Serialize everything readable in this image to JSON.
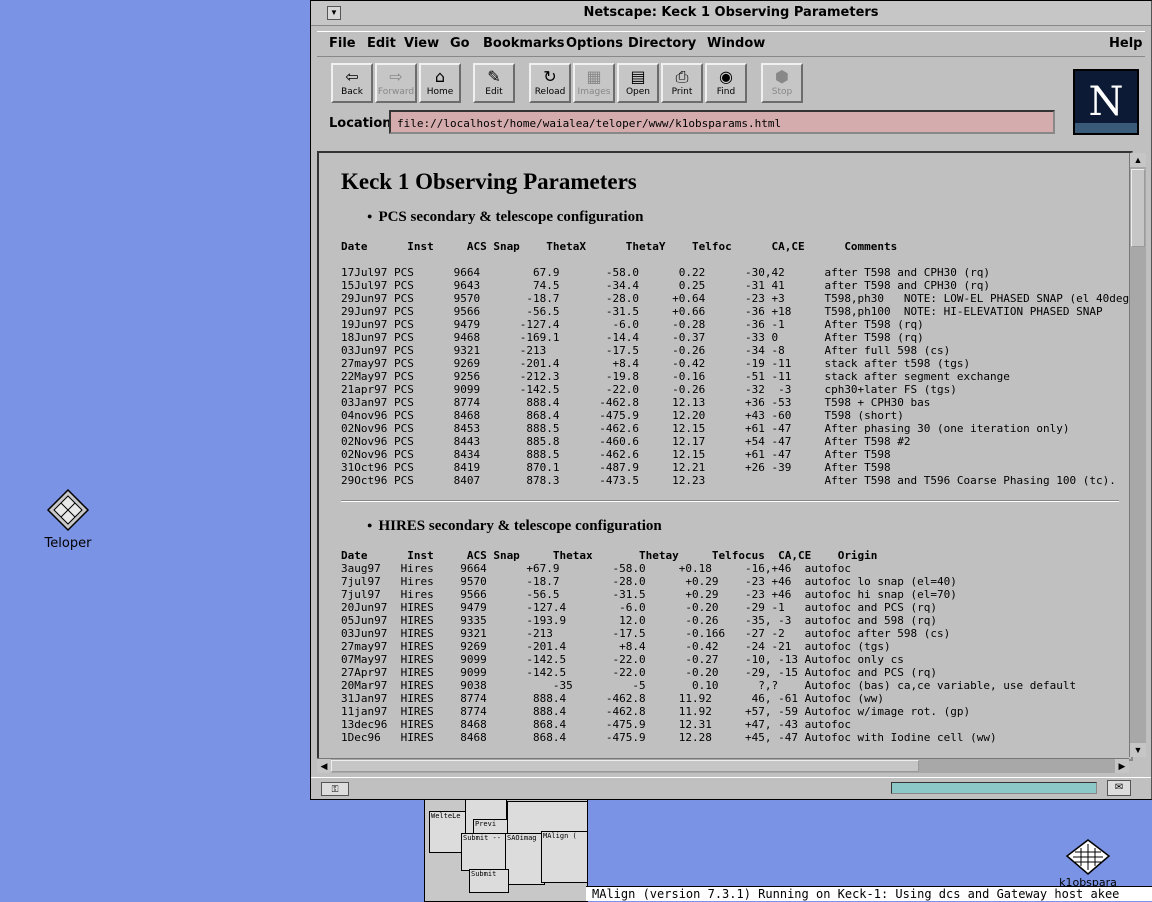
{
  "window": {
    "title": "Netscape: Keck 1 Observing Parameters"
  },
  "menubar": {
    "items": [
      "File",
      "Edit",
      "View",
      "Go",
      "Bookmarks",
      "Options",
      "Directory",
      "Window"
    ],
    "help": "Help"
  },
  "toolbar": {
    "back": "Back",
    "forward": "Forward",
    "home": "Home",
    "edit": "Edit",
    "reload": "Reload",
    "images": "Images",
    "open": "Open",
    "print": "Print",
    "find": "Find",
    "stop": "Stop"
  },
  "logo": {
    "letter": "N"
  },
  "location": {
    "label": "Location:",
    "value": "file://localhost/home/waialea/teloper/www/k1obsparams.html"
  },
  "page": {
    "heading": "Keck 1 Observing Parameters",
    "section1": {
      "title": "PCS secondary & telescope configuration",
      "header": "Date      Inst     ACS Snap    ThetaX      ThetaY    Telfoc      CA,CE      Comments",
      "rows": [
        "17Jul97 PCS      9664        67.9       -58.0      0.22      -30,42      after T598 and CPH30 (rq)",
        "15Jul97 PCS      9643        74.5       -34.4      0.25      -31 41      after T598 and CPH30 (rq)",
        "29Jun97 PCS      9570       -18.7       -28.0     +0.64      -23 +3      T598,ph30   NOTE: LOW-EL PHASED SNAP (el 40deg)",
        "29Jun97 PCS      9566       -56.5       -31.5     +0.66      -36 +18     T598,ph100  NOTE: HI-ELEVATION PHASED SNAP",
        "19Jun97 PCS      9479      -127.4        -6.0     -0.28      -36 -1      After T598 (rq)",
        "18Jun97 PCS      9468      -169.1       -14.4     -0.37      -33 0       After T598 (rq)",
        "03Jun97 PCS      9321      -213         -17.5     -0.26      -34 -8      After full 598 (cs)",
        "27may97 PCS      9269      -201.4        +8.4     -0.42      -19 -11     stack after t598 (tgs)",
        "22May97 PCS      9256      -212.3       -19.8     -0.16      -51 -11     stack after segment exchange",
        "21apr97 PCS      9099      -142.5       -22.0     -0.26      -32  -3     cph30+later FS (tgs)",
        "03Jan97 PCS      8774       888.4      -462.8     12.13      +36 -53     T598 + CPH30 bas",
        "04nov96 PCS      8468       868.4      -475.9     12.20      +43 -60     T598 (short)",
        "02Nov96 PCS      8453       888.5      -462.6     12.15      +61 -47     After phasing 30 (one iteration only)",
        "02Nov96 PCS      8443       885.8      -460.6     12.17      +54 -47     After T598 #2",
        "02Nov96 PCS      8434       888.5      -462.6     12.15      +61 -47     After T598",
        "31Oct96 PCS      8419       870.1      -487.9     12.21      +26 -39     After T598",
        "29Oct96 PCS      8407       878.3      -473.5     12.23                  After T598 and T596 Coarse Phasing 100 (tc)."
      ]
    },
    "section2": {
      "title": "HIRES secondary & telescope configuration",
      "header": "Date      Inst     ACS Snap     Thetax       Thetay     Telfocus  CA,CE    Origin",
      "rows": [
        "3aug97   Hires    9664      +67.9        -58.0     +0.18     -16,+46  autofoc",
        "7jul97   Hires    9570      -18.7        -28.0      +0.29    -23 +46  autofoc lo snap (el=40)",
        "7jul97   Hires    9566      -56.5        -31.5      +0.29    -23 +46  autofoc hi snap (el=70)",
        "20Jun97  HIRES    9479      -127.4        -6.0      -0.20    -29 -1   autofoc and PCS (rq)",
        "05Jun97  HIRES    9335      -193.9        12.0      -0.26    -35, -3  autofoc and 598 (rq)",
        "03Jun97  HIRES    9321      -213         -17.5      -0.166   -27 -2   autofoc after 598 (cs)",
        "27may97  HIRES    9269      -201.4        +8.4      -0.42    -24 -21  autofoc (tgs)",
        "07May97  HIRES    9099      -142.5       -22.0      -0.27    -10, -13 Autofoc only cs",
        "27Apr97  HIRES    9099      -142.5       -22.0      -0.20    -29, -15 Autofoc and PCS (rq)",
        "20Mar97  HIRES    9038          -35         -5       0.10      ?,?    Autofoc (bas) ca,ce variable, use default",
        "31Jan97  HIRES    8774       888.4      -462.8     11.92      46, -61 Autofoc (ww)",
        "11jan97  HIRES    8774       888.4      -462.8     11.92     +57, -59 Autofoc w/image rot. (gp)",
        "13dec96  HIRES    8468       868.4      -475.9     12.31     +47, -43 autofoc",
        "1Dec96   HIRES    8468       868.4      -475.9     12.28     +45, -47 Autofoc with Iodine cell (ww)"
      ]
    }
  },
  "status": {
    "progress": 1.0
  },
  "desktop": {
    "icon1": "Teloper",
    "icon2": "k1obspara",
    "thumb": {
      "t1": "WelteLe",
      "t2": "Previ",
      "t3": "Submit --",
      "t4": "SAOimag",
      "t5": "MAlign (",
      "t6": "Submit"
    },
    "terminal": "MAlign (version 7.3.1) Running on Keck-1: Using dcs and Gateway host akee"
  }
}
